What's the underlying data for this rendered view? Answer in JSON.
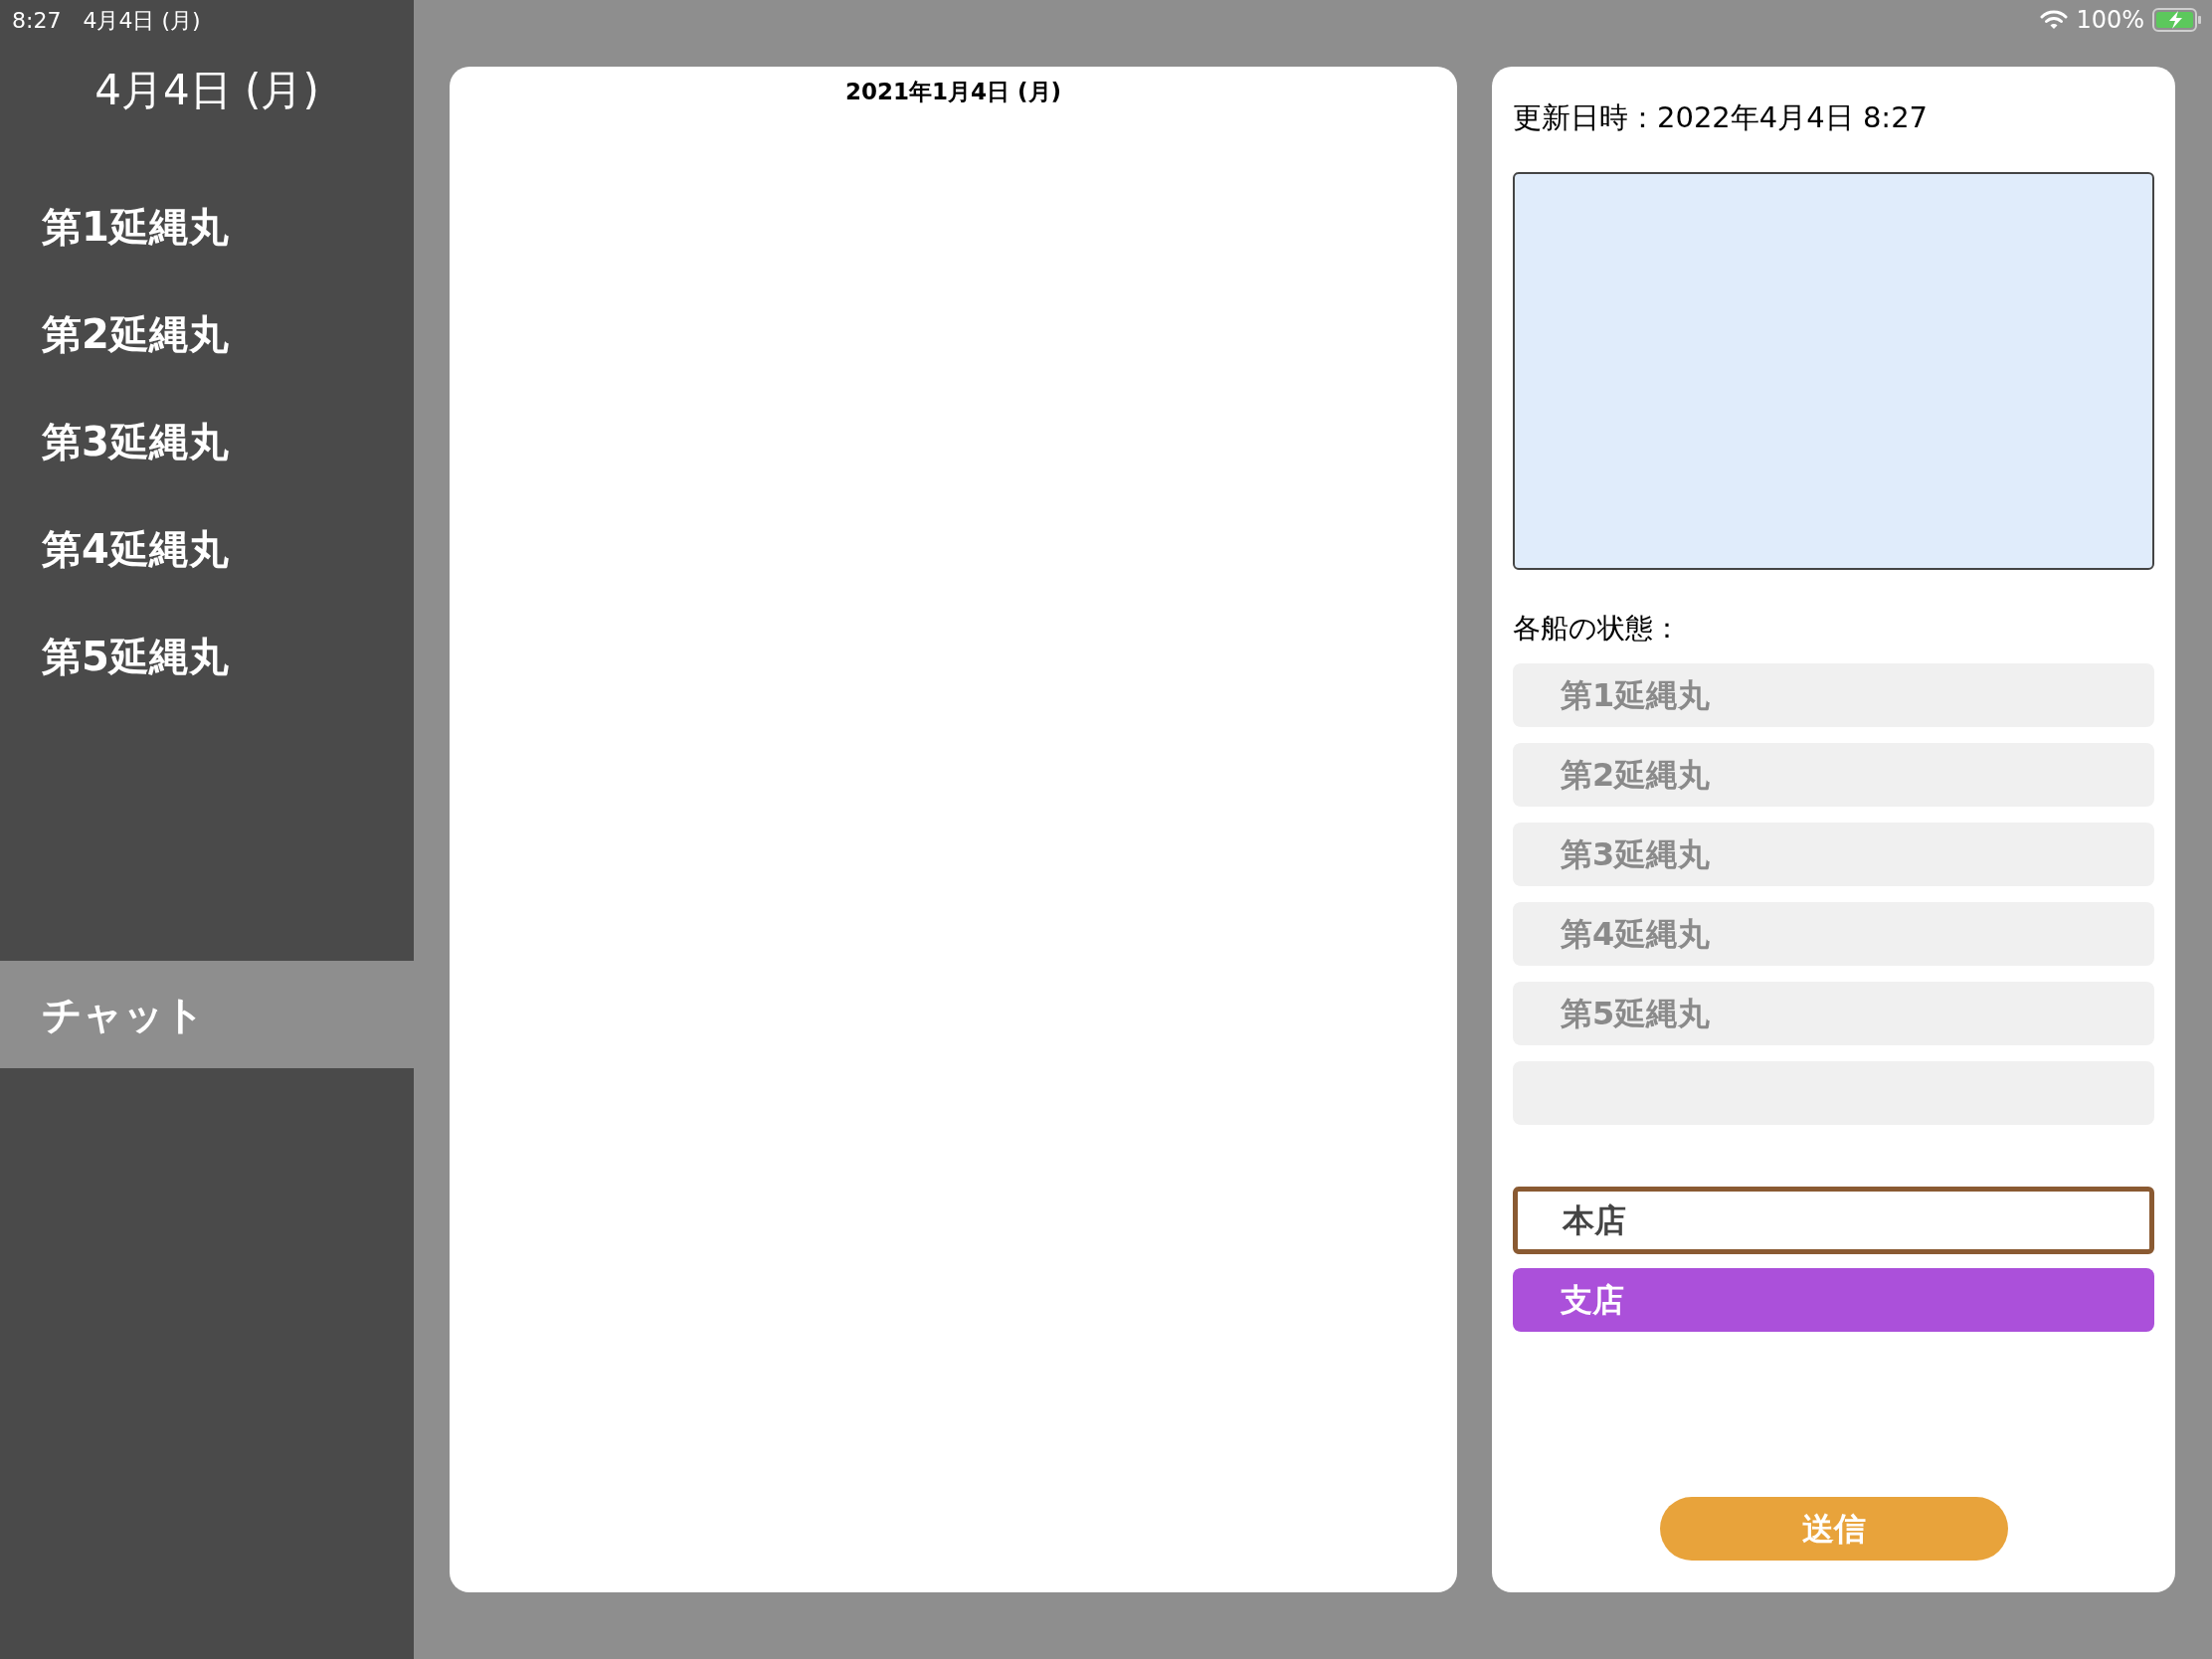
{
  "status_bar": {
    "time": "8:27",
    "date": "4月4日 (月)",
    "battery": "100%"
  },
  "sidebar": {
    "date": "4月4日 (月)",
    "items": [
      {
        "label": "第1延縄丸",
        "selected": false
      },
      {
        "label": "第2延縄丸",
        "selected": false
      },
      {
        "label": "第3延縄丸",
        "selected": false
      },
      {
        "label": "第4延縄丸",
        "selected": false
      },
      {
        "label": "第5延縄丸",
        "selected": false
      }
    ],
    "bottom_items": [
      {
        "label": "チャット",
        "selected": true
      }
    ]
  },
  "chat_panel": {
    "date": "2021年1月4日 (月)"
  },
  "form": {
    "updated": "更新日時：2022年4月4日 8:27",
    "status_label": "各船の状態：",
    "ships": [
      {
        "kind": "ship",
        "label": "第1延縄丸"
      },
      {
        "kind": "ship",
        "label": "第2延縄丸"
      },
      {
        "kind": "ship",
        "label": "第3延縄丸"
      },
      {
        "kind": "ship",
        "label": "第4延縄丸"
      },
      {
        "kind": "ship",
        "label": "第5延縄丸"
      },
      {
        "kind": "blank"
      }
    ],
    "branches": [
      {
        "kind": "outlined",
        "label": "本店",
        "color": "#8a5a32"
      },
      {
        "kind": "filled",
        "label": "支店",
        "color": "#ab50da"
      }
    ],
    "send": "送信"
  }
}
